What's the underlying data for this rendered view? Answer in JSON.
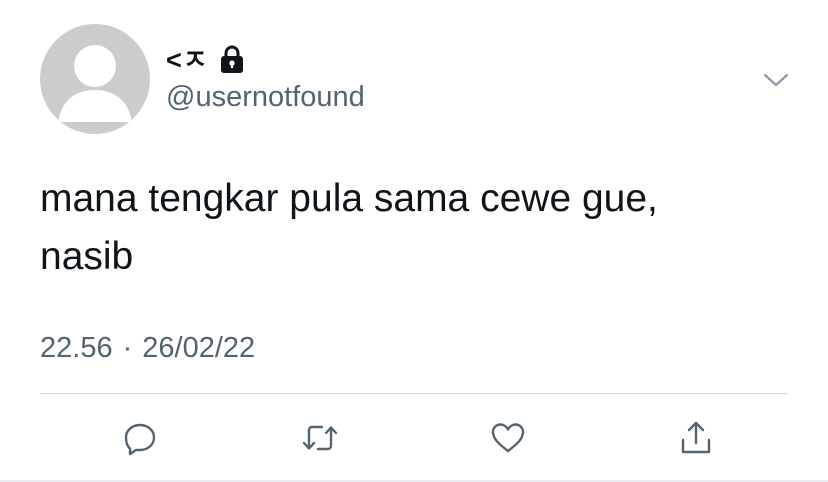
{
  "tweet": {
    "author": {
      "display_name": "<ㅈ",
      "handle": "@usernotfound",
      "protected": true,
      "avatar": "default-avatar"
    },
    "text": "mana tengkar pula sama cewe gue,\nnasib",
    "time": "22.56",
    "separator": "·",
    "date": "26/02/22"
  },
  "actions": [
    {
      "name": "reply",
      "icon": "reply-icon"
    },
    {
      "name": "retweet",
      "icon": "retweet-icon"
    },
    {
      "name": "like",
      "icon": "heart-icon"
    },
    {
      "name": "share",
      "icon": "share-icon"
    }
  ],
  "colors": {
    "text": "#0f1419",
    "secondary": "#536471",
    "icon": "#536471",
    "avatar_bg": "#cccccc",
    "divider": "#cfd9de"
  }
}
